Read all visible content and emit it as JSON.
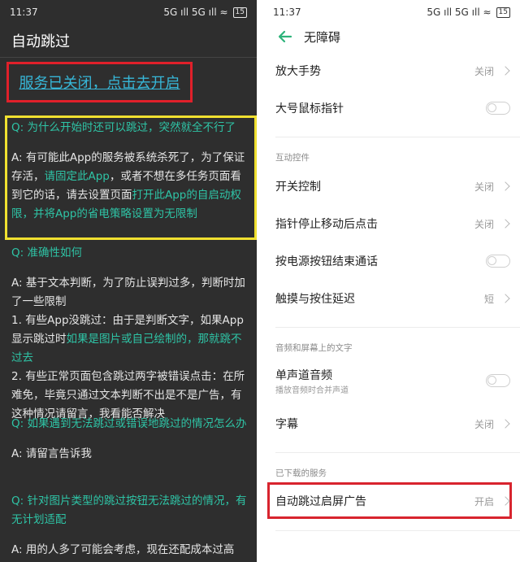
{
  "left": {
    "status": {
      "time": "11:37",
      "signal": "5G ıll 5G ıll ≈",
      "battery": "15"
    },
    "title": "自动跳过",
    "service_link": "服务已关闭，点击去开启",
    "faq": [
      {
        "q": "Q: 为什么开始时还可以跳过，突然就全不行了",
        "a1": "A: 有可能此App的服务被系统杀死了，为了保证存活，",
        "a_link1": "请固定此App",
        "a2": "，或者不想在多任务页面看到它的话，请去设置页面",
        "a_link2": "打开此App的自启动权限，并将App的省电策略设置为无限制"
      },
      {
        "q": "Q: 准确性如何",
        "a1": "A: 基于文本判断，为了防止误判过多，判断时加了一些限制",
        "p1a": "1. 有些App没跳过：由于是判断文字，如果App显示跳过时",
        "p1b": "如果是图片或自己绘制的，那就跳不过去",
        "p2": "2. 有些正常页面包含跳过两字被错误点击：在所难免，毕竟只通过文本判断不出是不是广告，有这种情况请留言，我看能否解决"
      },
      {
        "q": "Q: 如果遇到无法跳过或错误地跳过的情况怎么办",
        "a1": "A: 请留言告诉我"
      },
      {
        "q": "Q: 针对图片类型的跳过按钮无法跳过的情况，有无计划适配",
        "a1": "A: 用的人多了可能会考虑，现在还配成本过高"
      }
    ]
  },
  "right": {
    "status": {
      "time": "11:37",
      "signal": "5G ıll 5G ıll ≈",
      "battery": "15"
    },
    "title": "无障碍",
    "items": [
      {
        "label": "放大手势",
        "value": "关闭"
      },
      {
        "label": "大号鼠标指针"
      },
      {
        "section": "互动控件"
      },
      {
        "label": "开关控制",
        "value": "关闭"
      },
      {
        "label": "指针停止移动后点击",
        "value": "关闭"
      },
      {
        "label": "按电源按钮结束通话"
      },
      {
        "label": "触摸与按住延迟",
        "value": "短"
      },
      {
        "section": "音频和屏幕上的文字"
      },
      {
        "label": "单声道音频",
        "sub": "播放音频时合并声道"
      },
      {
        "label": "字幕",
        "value": "关闭"
      },
      {
        "section": "已下载的服务"
      },
      {
        "label": "自动跳过启屏广告",
        "value": "开启"
      }
    ]
  }
}
